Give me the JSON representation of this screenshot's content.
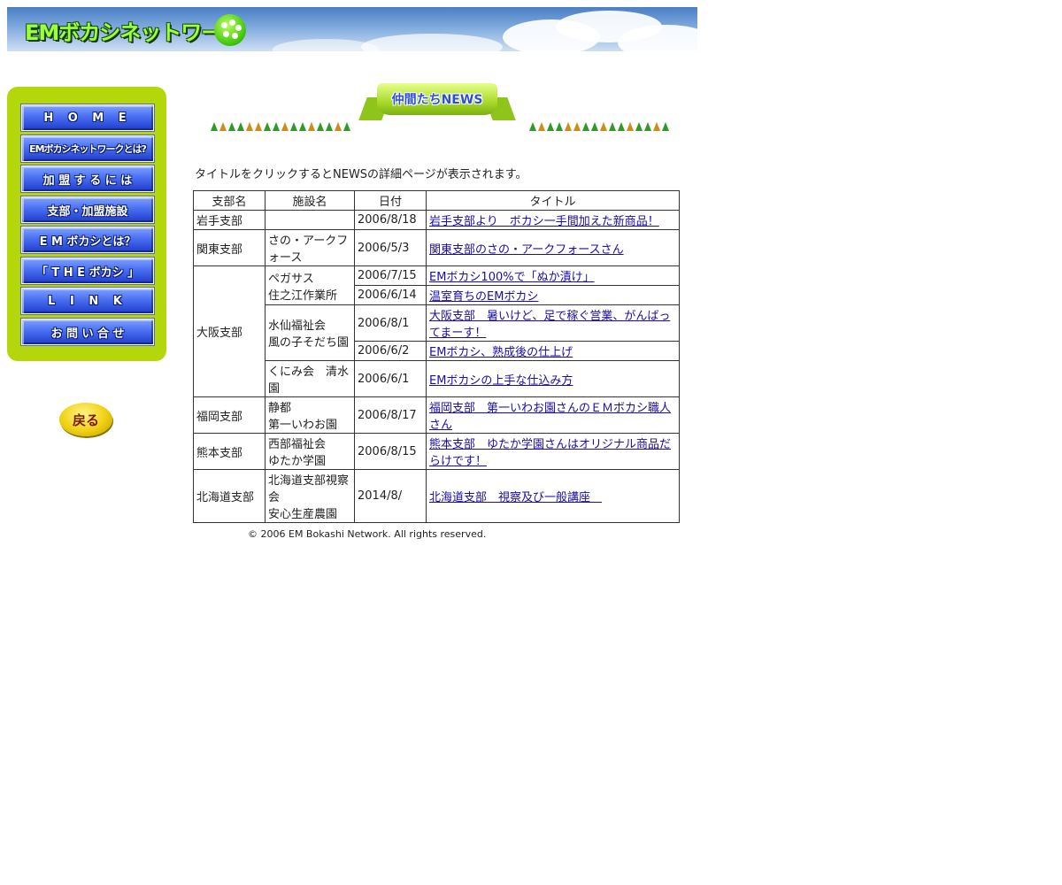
{
  "banner": {
    "title": "EMボカシネットワーク"
  },
  "sidebar": {
    "items": [
      {
        "label": "H O M E"
      },
      {
        "label": "EMボカシネットワークとは?"
      },
      {
        "label": "加 盟 す る に は"
      },
      {
        "label": "支部・加盟施設"
      },
      {
        "label": "E M ボカシとは？"
      },
      {
        "label": "「 T H E ボカシ 」"
      },
      {
        "label": "L I N K"
      },
      {
        "label": "お 問 い 合 せ"
      }
    ],
    "back_label": "戻る"
  },
  "news_header": {
    "title": "仲間たちNEWS"
  },
  "intro": "タイトルをクリックするとNEWSの詳細ページが表示されます。",
  "table": {
    "headers": [
      "支部名",
      "施設名",
      "日付",
      "タイトル"
    ],
    "rows": [
      {
        "branch": "岩手支部",
        "facility": "",
        "date": "2006/8/18",
        "title": "岩手支部より　ボカシ一手間加えた新商品！"
      },
      {
        "branch": "関東支部",
        "facility": "さの・アークフォース",
        "date": "2006/5/3",
        "title": "関東支部のさの・アークフォースさん"
      },
      {
        "branch": "大阪支部",
        "facility": "ペガサス\n住之江作業所",
        "date": "2006/7/15",
        "title": "EMボカシ100%で「ぬか漬け」"
      },
      {
        "date": "2006/6/14",
        "title": "温室育ちのEMボカシ"
      },
      {
        "facility": "水仙福祉会\n風の子そだち園",
        "date": "2006/8/1",
        "title": "大阪支部　暑いけど、足で稼ぐ営業、がんばってまーす！"
      },
      {
        "date": "2006/6/2",
        "title": "EMボカシ、熟成後の仕上げ"
      },
      {
        "facility": "くにみ会　清水園",
        "date": "2006/6/1",
        "title": "EMボカシの上手な仕込み方"
      },
      {
        "branch": "福岡支部",
        "facility": "静都\n第一いわお園",
        "date": "2006/8/17",
        "title": "福岡支部　第一いわお園さんのＥＭボカシ職人さん"
      },
      {
        "branch": "熊本支部",
        "facility": "西部福祉会\nゆたか学園",
        "date": "2006/8/15",
        "title": "熊本支部　ゆたか学園さんはオリジナル商品だらけです！"
      },
      {
        "branch": "北海道支部",
        "facility": "北海道支部視察会\n安心生産農園",
        "date": "2014/8/",
        "title": "北海道支部　視察及び一般講座　"
      }
    ]
  },
  "footer": "© 2006 EM Bokashi Network. All rights reserved."
}
